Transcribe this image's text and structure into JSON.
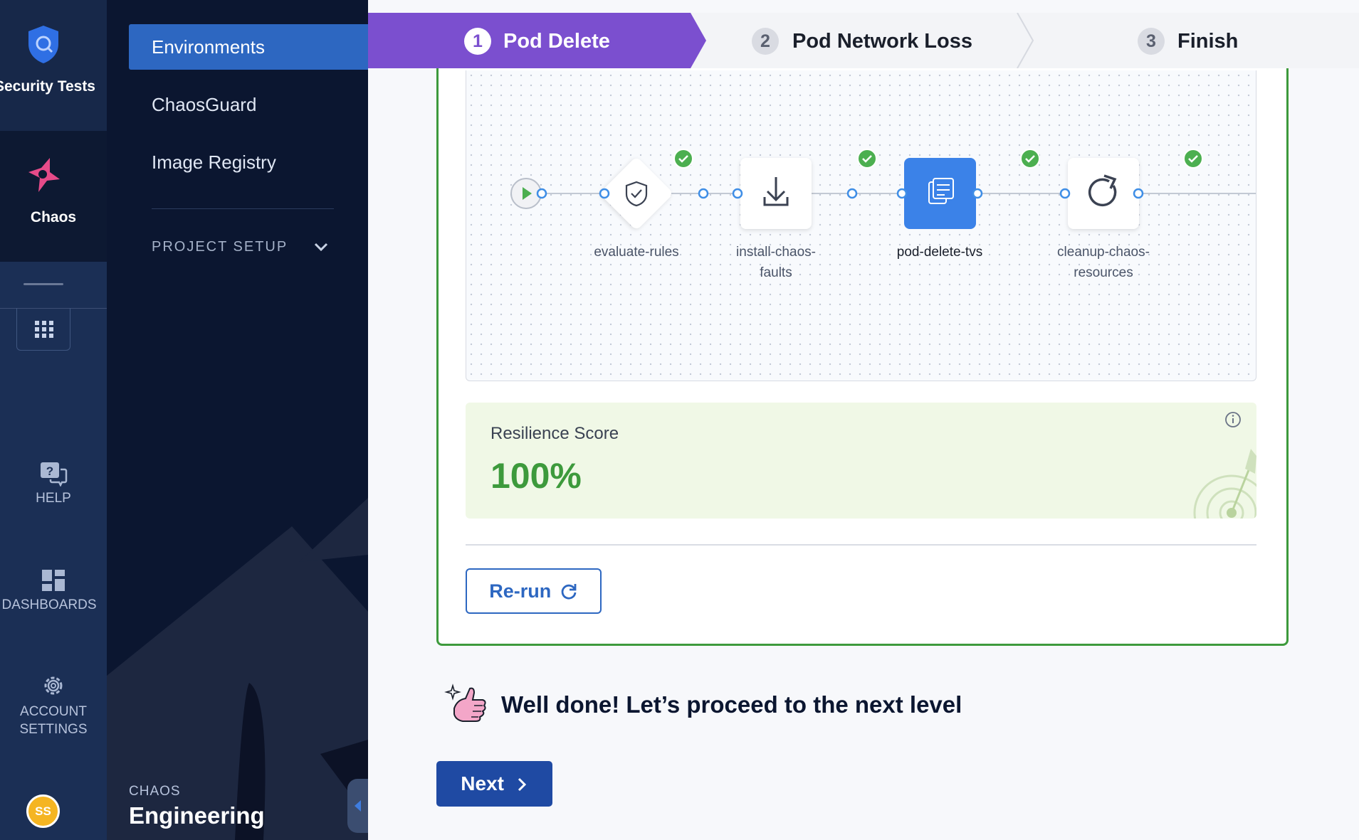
{
  "rail": {
    "top_label": "Security Tests",
    "chaos_label": "Chaos",
    "help_label": "HELP",
    "dashboards_label": "DASHBOARDS",
    "account_line1": "ACCOUNT",
    "account_line2": "SETTINGS",
    "avatar_initials": "SS"
  },
  "nav": {
    "items": [
      {
        "label": "Environments"
      },
      {
        "label": "ChaosGuard"
      },
      {
        "label": "Image Registry"
      }
    ],
    "section_label": "PROJECT SETUP",
    "footer_small": "CHAOS",
    "footer_big": "Engineering"
  },
  "stepper": {
    "steps": [
      {
        "number": "1",
        "label": "Pod Delete"
      },
      {
        "number": "2",
        "label": "Pod Network Loss"
      },
      {
        "number": "3",
        "label": "Finish"
      }
    ]
  },
  "pipeline": {
    "nodes": [
      {
        "label": "evaluate-rules"
      },
      {
        "label_line1": "install-chaos-",
        "label_line2": "faults"
      },
      {
        "label": "pod-delete-tvs"
      },
      {
        "label_line1": "cleanup-chaos-",
        "label_line2": "resources"
      }
    ]
  },
  "score": {
    "label": "Resilience Score",
    "value": "100%"
  },
  "rerun_label": "Re-run",
  "message": "Well done! Let’s proceed to the next level",
  "next_label": "Next",
  "colors": {
    "accent_purple": "#7b4fcf",
    "primary_blue": "#2d67c1",
    "success_green": "#3d9a3c",
    "rail_bg": "#1b2f55",
    "nav_bg": "#0b1630"
  }
}
